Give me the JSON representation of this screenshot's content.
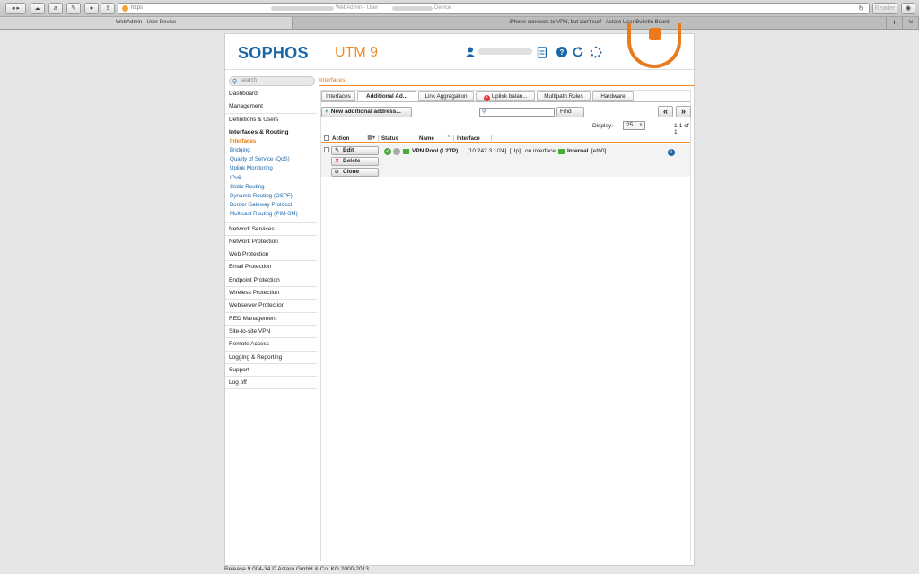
{
  "browser": {
    "url_prefix": "https",
    "title_part1": "WebAdmin - User",
    "title_part2": "Device",
    "reader_label": "Reader",
    "tabs": [
      {
        "label": "WebAdmin - User                Device"
      },
      {
        "label": "iPhone connects to VPN, but can't surf - Astaro User Bulletin Board"
      }
    ]
  },
  "header": {
    "logo": "SOPHOS",
    "product": "UTM 9"
  },
  "search": {
    "placeholder": "search"
  },
  "breadcrumb": "Interfaces",
  "sidebar": {
    "top_items": [
      "Dashboard",
      "Management",
      "Definitions & Users"
    ],
    "group": {
      "title": "Interfaces & Routing",
      "items": [
        "Interfaces",
        "Bridging",
        "Quality of Service (QoS)",
        "Uplink Monitoring",
        "IPv6",
        "Static Routing",
        "Dynamic Routing (OSPF)",
        "Border Gateway Protocol",
        "Multicast Routing (PIM-SM)"
      ]
    },
    "bottom_items": [
      "Network Services",
      "Network Protection",
      "Web Protection",
      "Email Protection",
      "Endpoint Protection",
      "Wireless Protection",
      "Webserver Protection",
      "RED Management",
      "Site-to-site VPN",
      "Remote Access",
      "Logging & Reporting",
      "Support",
      "Log off"
    ]
  },
  "tabs": [
    "Interfaces",
    "Additional Ad...",
    "Link Aggregation",
    "Uplink balan...",
    "Multipath Rules",
    "Hardware"
  ],
  "toolbar": {
    "new_label": "New additional address...",
    "find_label": "Find",
    "prev_label": "«",
    "next_label": "»",
    "display_label": "Display:",
    "display_value": "25",
    "count": "1-1 of 1"
  },
  "table": {
    "headers": [
      "Action",
      "Status",
      "Name",
      "Interface"
    ],
    "row": {
      "actions": [
        "Edit",
        "Delete",
        "Clone"
      ],
      "name": "VPN Pool (L2TP)",
      "address": "[10.242.3.1/24]",
      "state": "[Up]",
      "on_interface": "on interface",
      "iface_name": "Internal",
      "iface_dev": "[eth0]"
    }
  },
  "footer": "Release 9.004-34  © Astaro GmbH & Co. KG 2000-2013",
  "colors": {
    "brand_blue": "#1b66a9",
    "accent_orange": "#f28c28",
    "ok_green": "#4caa3c"
  }
}
